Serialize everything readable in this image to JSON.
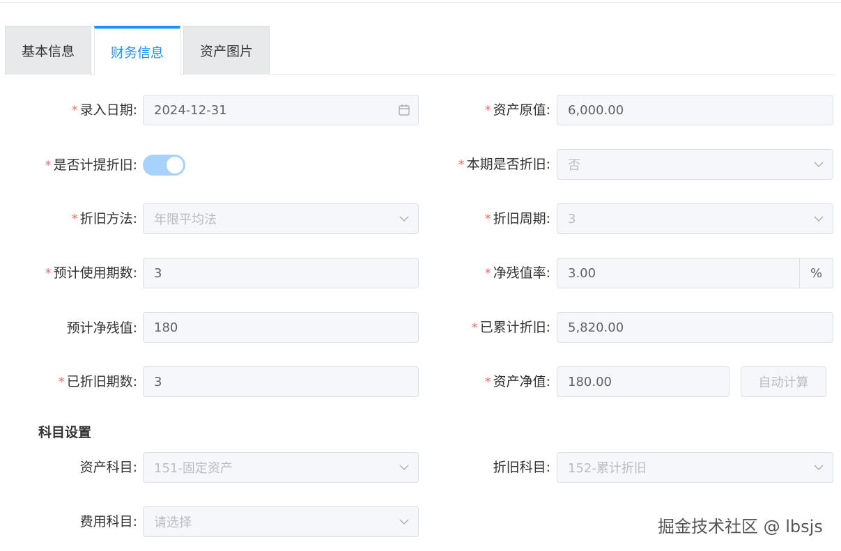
{
  "tabs": [
    "基本信息",
    "财务信息",
    "资产图片"
  ],
  "active_tab": 1,
  "form": {
    "entry_date": {
      "label": "录入日期:",
      "required": "*",
      "value": "2024-12-31",
      "icon": "calendar-icon"
    },
    "original_value": {
      "label": "资产原值:",
      "required": "*",
      "value": "6,000.00"
    },
    "depreciate_flag": {
      "label": "是否计提折旧:",
      "required": "*",
      "state": "on"
    },
    "current_period_depreciate": {
      "label": "本期是否折旧:",
      "required": "*",
      "value": "否"
    },
    "depreciation_method": {
      "label": "折旧方法:",
      "required": "*",
      "value": "年限平均法"
    },
    "depreciation_cycle": {
      "label": "折旧周期:",
      "required": "*",
      "value": "3"
    },
    "expected_periods": {
      "label": "预计使用期数:",
      "required": "*",
      "value": "3"
    },
    "residual_rate": {
      "label": "净残值率:",
      "required": "*",
      "value": "3.00",
      "suffix": "%"
    },
    "expected_residual": {
      "label": "预计净残值:",
      "value": "180"
    },
    "accumulated_depreciation": {
      "label": "已累计折旧:",
      "required": "*",
      "value": "5,820.00"
    },
    "depreciated_periods": {
      "label": "已折旧期数:",
      "required": "*",
      "value": "3"
    },
    "net_value": {
      "label": "资产净值:",
      "required": "*",
      "value": "180.00"
    },
    "auto_calc_button": "自动计算"
  },
  "accounts": {
    "title": "科目设置",
    "asset_account": {
      "label": "资产科目:",
      "value": "151-固定资产"
    },
    "depreciation_account": {
      "label": "折旧科目:",
      "value": "152-累计折旧"
    },
    "expense_account": {
      "label": "费用科目:",
      "placeholder": "请选择"
    }
  },
  "watermark": "掘金技术社区 @ lbsjs",
  "colors": {
    "accent": "#1890ff",
    "required": "#f56c6c",
    "disabled_bg": "#f5f7fa",
    "switch_on": "#a7d2fb"
  }
}
